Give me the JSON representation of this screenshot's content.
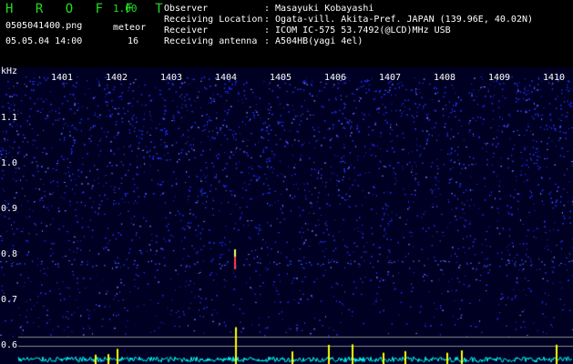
{
  "header": {
    "app_name": "H R O F F T",
    "version": "1.00",
    "filename": "0505041400.png",
    "meteor_label": "meteor",
    "meteor_count": "16",
    "timestamp": "05.05.04 14:00"
  },
  "station": {
    "rows": [
      {
        "label": "Observer",
        "value": ": Masayuki Kobayashi"
      },
      {
        "label": "Receiving Location",
        "value": ": Ogata-vill. Akita-Pref. JAPAN (139.96E, 40.02N)"
      },
      {
        "label": "Receiver",
        "value": ": ICOM IC-575 53.7492(@LCD)MHz USB"
      },
      {
        "label": "Receiving antenna",
        "value": ": A504HB(yagi 4el)"
      }
    ]
  },
  "spectrogram": {
    "y_unit": "kHz",
    "y_ticks": [
      "1.1",
      "1.0",
      "0.9",
      "0.8",
      "0.7",
      "0.6"
    ],
    "x_ticks": [
      "1401",
      "1402",
      "1403",
      "1404",
      "1405",
      "1406",
      "1407",
      "1408",
      "1409",
      "1410"
    ],
    "colors": {
      "background": "#000022",
      "noise": "#2233ff",
      "signal": "#ffff00",
      "trace": "#00ffff"
    }
  }
}
